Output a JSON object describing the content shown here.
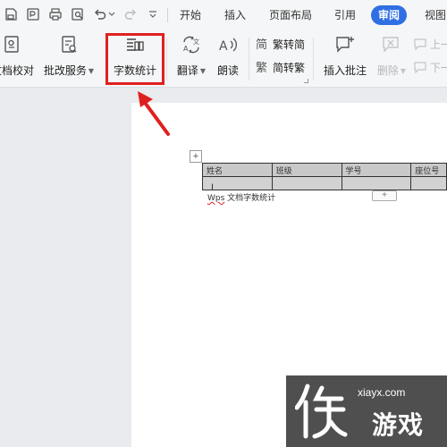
{
  "tabbar": {
    "quick_access_icons": [
      "save-icon",
      "export-pdf-icon",
      "print-icon",
      "print-preview-icon",
      "undo-icon",
      "redo-icon",
      "more-dropdown-icon"
    ],
    "tabs": [
      {
        "label": "开始"
      },
      {
        "label": "插入"
      },
      {
        "label": "页面布局"
      },
      {
        "label": "引用"
      },
      {
        "label": "审阅",
        "active": true
      },
      {
        "label": "视图"
      }
    ]
  },
  "ribbon": {
    "doc_check": "文档校对",
    "review_service": "批改服务",
    "word_count": "字数统计",
    "translate": "翻译",
    "read_aloud": "朗读",
    "trad_to_simp": "繁转简",
    "simp_to_trad": "简转繁",
    "insert_comment": "插入批注",
    "delete": "删除",
    "prev": "上一",
    "next": "下一"
  },
  "document": {
    "table_headers": [
      "姓名",
      "班级",
      "学号",
      "座位号"
    ],
    "body_text_prefix": "Wps",
    "body_text": " 文档字数统计",
    "add_row_symbol": "+",
    "move_handle_symbol": "+",
    "cursor_symbol": "I"
  },
  "watermark": {
    "url": "xiayx.com",
    "brand": "游戏"
  },
  "colors": {
    "accent_blue": "#2f6fe4",
    "highlight_red": "#e02020",
    "ribbon_bg": "#f5f6f7",
    "table_header_bg": "#c9c9c9"
  }
}
